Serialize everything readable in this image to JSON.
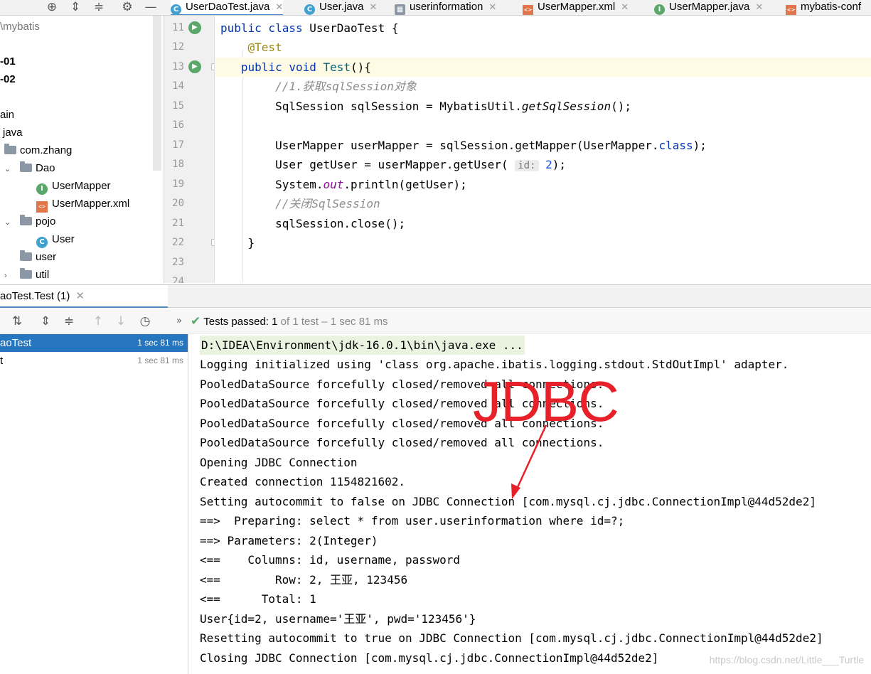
{
  "colors": {
    "accent": "#4a88c7",
    "selection": "#2675bf",
    "keyword": "#0033b3",
    "annotation_red": "#e8202a",
    "pass_green": "#59a869"
  },
  "tabs": [
    {
      "label": "UserDaoTest.java",
      "icon": "class-c-icon",
      "icon_color": "#40a0d0",
      "active": true
    },
    {
      "label": "User.java",
      "icon": "class-c-icon",
      "icon_color": "#40a0d0",
      "active": false
    },
    {
      "label": "userinformation",
      "icon": "table-icon",
      "icon_color": "#8b97a5",
      "active": false
    },
    {
      "label": "UserMapper.xml",
      "icon": "xml-icon",
      "icon_color": "#e0764a",
      "active": false
    },
    {
      "label": "UserMapper.java",
      "icon": "interface-i-icon",
      "icon_color": "#59a869",
      "active": false
    },
    {
      "label": "mybatis-conf",
      "icon": "xml-icon",
      "icon_color": "#e0764a",
      "active": false
    }
  ],
  "project_tree": {
    "root_label": "\\mybatis",
    "module_01": "-01",
    "module_02": "-02",
    "main_label": "ain",
    "java_label": "java",
    "package_label": "com.zhang",
    "dao_label": "Dao",
    "usermapper_label": "UserMapper",
    "usermapper_xml_label": "UserMapper.xml",
    "pojo_label": "pojo",
    "user_class_label": "User",
    "user_pkg_label": "user",
    "util_label": "util"
  },
  "editor": {
    "line_numbers": [
      "11",
      "12",
      "13",
      "14",
      "15",
      "16",
      "17",
      "18",
      "19",
      "20",
      "21",
      "22",
      "23",
      "24"
    ],
    "lines": {
      "l11_kw": "public class ",
      "l11_rest": "UserDaoTest {",
      "l12": "@Test",
      "l13_kw": "public void ",
      "l13_fn": "Test",
      "l13_rest": "(){",
      "l14": "//1.获取sqlSession对象",
      "l15_a": "SqlSession sqlSession = MybatisUtil.",
      "l15_b": "getSqlSession",
      "l15_c": "();",
      "l17_a": "UserMapper userMapper = sqlSession.getMapper(UserMapper.",
      "l17_kw": "class",
      "l17_c": ");",
      "l18_a": "User getUser = userMapper.getUser( ",
      "l18_hint": "id:",
      "l18_num": " 2",
      "l18_c": ");",
      "l19_a": "System.",
      "l19_b": "out",
      "l19_c": ".println(getUser);",
      "l20": "//关闭SqlSession",
      "l21": "sqlSession.close();",
      "l22": "}"
    }
  },
  "run": {
    "tab_label": "aoTest.Test (1)",
    "status_main": "Tests passed:",
    "status_count": " 1",
    "status_sub": " of 1 test – 1 sec 81 ms",
    "tests": [
      {
        "name": "aoTest",
        "time": "1 sec 81 ms"
      },
      {
        "name": "t",
        "time": "1 sec 81 ms"
      }
    ]
  },
  "console": [
    "D:\\IDEA\\Environment\\jdk-16.0.1\\bin\\java.exe ...",
    "Logging initialized using 'class org.apache.ibatis.logging.stdout.StdOutImpl' adapter.",
    "PooledDataSource forcefully closed/removed all connections.",
    "PooledDataSource forcefully closed/removed all connections.",
    "PooledDataSource forcefully closed/removed all connections.",
    "PooledDataSource forcefully closed/removed all connections.",
    "Opening JDBC Connection",
    "Created connection 1154821602.",
    "Setting autocommit to false on JDBC Connection [com.mysql.cj.jdbc.ConnectionImpl@44d52de2]",
    "==>  Preparing: select * from user.userinformation where id=?;",
    "==> Parameters: 2(Integer)",
    "<==    Columns: id, username, password",
    "<==        Row: 2, 王亚, 123456",
    "<==      Total: 1",
    "User{id=2, username='王亚', pwd='123456'}",
    "Resetting autocommit to true on JDBC Connection [com.mysql.cj.jdbc.ConnectionImpl@44d52de2]",
    "Closing JDBC Connection [com.mysql.cj.jdbc.ConnectionImpl@44d52de2]"
  ],
  "annotation": {
    "text": "JDBC"
  },
  "watermark": "https://blog.csdn.net/Little___Turtle"
}
